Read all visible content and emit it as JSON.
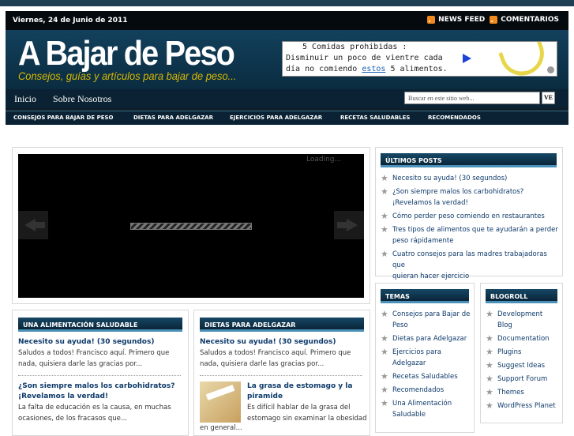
{
  "header": {
    "date": "Viernes, 24 de Junio de 2011",
    "news_feed": "NEWS FEED",
    "comments": "COMENTARIOS",
    "logo": "A Bajar de Peso",
    "tagline": "Consejos, guías y artículos para bajar de peso...",
    "ad": {
      "line1": "5 Comidas prohibidas :",
      "line2": "Disminuir un poco de vientre cada",
      "line3_pre": "día no comiendo ",
      "line3_link": "estos",
      "line3_post": " 5 alimentos."
    }
  },
  "nav": {
    "items": [
      "Inicio",
      "Sobre Nosotros"
    ],
    "search_placeholder": "Buscar en este sitio web...",
    "go_label": "VE"
  },
  "categories": [
    "CONSEJOS PARA BAJAR DE PESO",
    "DIETAS PARA ADELGAZAR",
    "EJERCICIOS PARA ADELGAZAR",
    "RECETAS SALUDABLES",
    "RECOMENDADOS"
  ],
  "slider": {
    "loading": "Loading..."
  },
  "sections": {
    "left": {
      "heading": "UNA ALIMENTACIÓN SALUDABLE",
      "posts": [
        {
          "title": "Necesito su ayuda! (30 segundos)",
          "excerpt": [
            "Saludos a todos! Francisco aquí. Primero que",
            "nada, quisiera darle las gracias por..."
          ]
        },
        {
          "title": [
            "¿Son siempre malos los carbohidratos?",
            "¡Revelamos la verdad!"
          ],
          "excerpt": [
            "La falta de educación es la causa, en muchas",
            "ocasiones, de los fracasos que..."
          ]
        }
      ]
    },
    "middle": {
      "heading": "DIETAS PARA ADELGAZAR",
      "posts": [
        {
          "title": "Necesito su ayuda! (30 segundos)",
          "excerpt": [
            "Saludos a todos! Francisco aquí. Primero que",
            "nada, quisiera darle las gracias por..."
          ]
        },
        {
          "title": [
            "La grasa de estomago y la",
            "piramide"
          ],
          "excerpt": [
            "Es difícil hablar de la grasa del",
            "estomago sin examinar la obesidad",
            "en general..."
          ]
        }
      ]
    }
  },
  "sidebar": {
    "recent_heading": "ÚLTIMOS POSTS",
    "recent": [
      [
        "Necesito su ayuda! (30 segundos)"
      ],
      [
        "¿Son siempre malos los carbohidratos?",
        "¡Revelamos la verdad!"
      ],
      [
        "Cómo perder peso comiendo en restaurantes"
      ],
      [
        "Tres tipos de alimentos que te ayudarán a perder",
        "peso rápidamente"
      ],
      [
        "Cuatro consejos para las madres trabajadoras que",
        "quieran hacer ejercicio"
      ]
    ],
    "topics_heading": "TEMAS",
    "topics": [
      [
        "Consejos para Bajar de",
        "Peso"
      ],
      [
        "Dietas para Adelgazar"
      ],
      [
        "Ejercicios para",
        "Adelgazar"
      ],
      [
        "Recetas Saludables"
      ],
      [
        "Recomendados"
      ],
      [
        "Una Alimentación",
        "Saludable"
      ]
    ],
    "blogroll_heading": "BLOGROLL",
    "blogroll": [
      [
        "Development",
        "Blog"
      ],
      [
        "Documentation"
      ],
      [
        "Plugins"
      ],
      [
        "Suggest Ideas"
      ],
      [
        "Support Forum"
      ],
      [
        "Themes"
      ],
      [
        "WordPress Planet"
      ]
    ]
  },
  "colors": {
    "dark_navy": "#0a2233",
    "accent_blue": "#4a90b8",
    "link": "#0e3a6a",
    "tagline_yellow": "#d8b800",
    "rss_orange": "#f08a1c"
  }
}
